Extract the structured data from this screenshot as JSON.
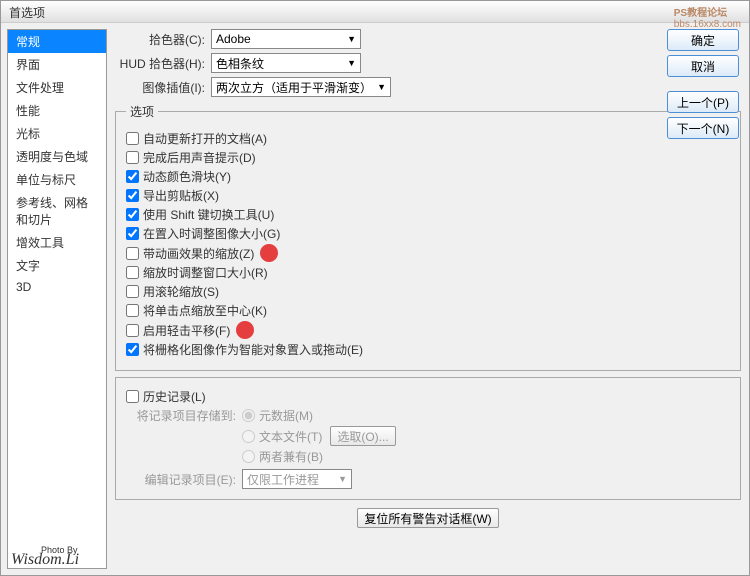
{
  "window": {
    "title": "首选项"
  },
  "watermark": {
    "top1": "PS教程论坛",
    "top2": "bbs.16xx8.com",
    "bottom_small": "Photo By",
    "bottom": "Wisdom.Li"
  },
  "sidebar": {
    "items": [
      {
        "label": "常规",
        "selected": true
      },
      {
        "label": "界面"
      },
      {
        "label": "文件处理"
      },
      {
        "label": "性能"
      },
      {
        "label": "光标"
      },
      {
        "label": "透明度与色域"
      },
      {
        "label": "单位与标尺"
      },
      {
        "label": "参考线、网格和切片"
      },
      {
        "label": "增效工具"
      },
      {
        "label": "文字"
      },
      {
        "label": "3D"
      }
    ]
  },
  "form": {
    "picker_label": "拾色器(C):",
    "picker_value": "Adobe",
    "hud_label": "HUD 拾色器(H):",
    "hud_value": "色相条纹",
    "interp_label": "图像插值(I):",
    "interp_value": "两次立方（适用于平滑渐变）"
  },
  "options": {
    "legend": "选项",
    "items": [
      {
        "label": "自动更新打开的文档(A)",
        "checked": false
      },
      {
        "label": "完成后用声音提示(D)",
        "checked": false
      },
      {
        "label": "动态颜色滑块(Y)",
        "checked": true
      },
      {
        "label": "导出剪贴板(X)",
        "checked": true
      },
      {
        "label": "使用 Shift 键切换工具(U)",
        "checked": true
      },
      {
        "label": "在置入时调整图像大小(G)",
        "checked": true
      },
      {
        "label": "带动画效果的缩放(Z)",
        "checked": false,
        "marker": true
      },
      {
        "label": "缩放时调整窗口大小(R)",
        "checked": false
      },
      {
        "label": "用滚轮缩放(S)",
        "checked": false
      },
      {
        "label": "将单击点缩放至中心(K)",
        "checked": false
      },
      {
        "label": "启用轻击平移(F)",
        "checked": false,
        "marker": true
      },
      {
        "label": "将栅格化图像作为智能对象置入或拖动(E)",
        "checked": true
      }
    ]
  },
  "history": {
    "legend_label": "历史记录(L)",
    "save_label": "将记录项目存储到:",
    "r1": "元数据(M)",
    "r2": "文本文件(T)",
    "choose_btn": "选取(O)...",
    "r3": "两者兼有(B)",
    "edit_label": "编辑记录项目(E):",
    "edit_value": "仅限工作进程"
  },
  "reset_btn": "复位所有警告对话框(W)",
  "buttons": {
    "ok": "确定",
    "cancel": "取消",
    "prev": "上一个(P)",
    "next": "下一个(N)"
  }
}
